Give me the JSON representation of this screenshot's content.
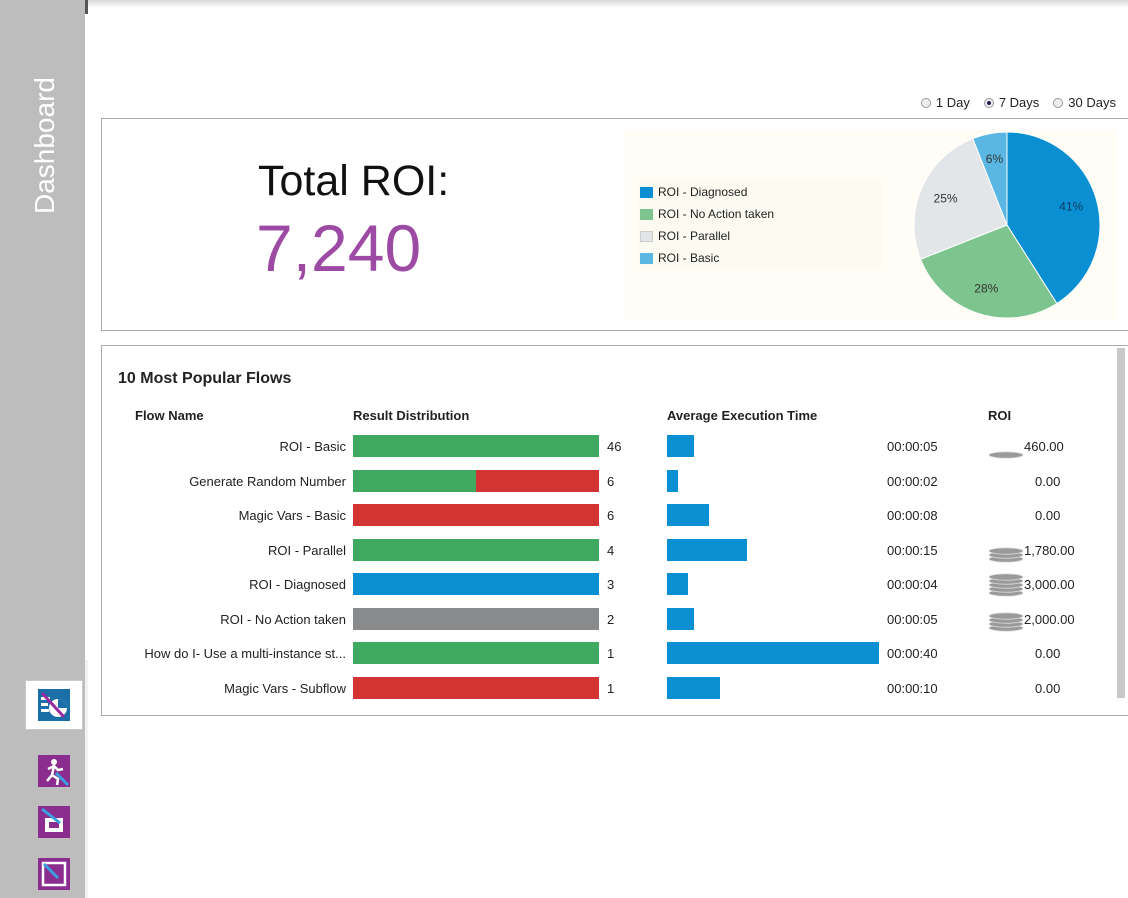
{
  "sidebar": {
    "title": "Dashboard",
    "nav": [
      {
        "name": "dashboard-nav-icon",
        "active": true
      },
      {
        "name": "run-nav-icon",
        "active": false
      },
      {
        "name": "scheduler-nav-icon",
        "active": false
      },
      {
        "name": "content-nav-icon",
        "active": false
      }
    ]
  },
  "range": {
    "options": [
      "1 Day",
      "7 Days",
      "30 Days"
    ],
    "selected": "7 Days"
  },
  "roi": {
    "title": "Total ROI:",
    "value": "7,240"
  },
  "chart_data": {
    "type": "pie",
    "labels": [
      "ROI - Diagnosed",
      "ROI - No Action taken",
      "ROI - Parallel",
      "ROI - Basic"
    ],
    "values": [
      41,
      28,
      25,
      6
    ],
    "value_labels": [
      "41%",
      "28%",
      "25%",
      "6%"
    ],
    "colors": [
      "#0a8fd3",
      "#7dc48e",
      "#e3e6e8",
      "#5ab7e3"
    ]
  },
  "flows": {
    "title": "10 Most Popular Flows",
    "headers": {
      "name": "Flow Name",
      "result": "Result Distribution",
      "time": "Average Execution Time",
      "roi": "ROI"
    },
    "rows": [
      {
        "name": "ROI - Basic",
        "count": "46",
        "time": "00:00:05",
        "roi": "460.00",
        "seconds": 5,
        "coins": 1,
        "segments": [
          {
            "color": "#3fa95f",
            "frac": 1
          }
        ]
      },
      {
        "name": "Generate Random Number",
        "count": "6",
        "time": "00:00:02",
        "roi": "0.00",
        "seconds": 2,
        "coins": 0,
        "segments": [
          {
            "color": "#3fa95f",
            "frac": 0.5
          },
          {
            "color": "#d23434",
            "frac": 0.5
          }
        ]
      },
      {
        "name": "Magic Vars - Basic",
        "count": "6",
        "time": "00:00:08",
        "roi": "0.00",
        "seconds": 8,
        "coins": 0,
        "segments": [
          {
            "color": "#d23434",
            "frac": 1
          }
        ]
      },
      {
        "name": "ROI - Parallel",
        "count": "4",
        "time": "00:00:15",
        "roi": "1,780.00",
        "seconds": 15,
        "coins": 3,
        "segments": [
          {
            "color": "#3fa95f",
            "frac": 1
          }
        ]
      },
      {
        "name": "ROI - Diagnosed",
        "count": "3",
        "time": "00:00:04",
        "roi": "3,000.00",
        "seconds": 4,
        "coins": 5,
        "segments": [
          {
            "color": "#0a8fd3",
            "frac": 1
          }
        ]
      },
      {
        "name": "ROI - No Action taken",
        "count": "2",
        "time": "00:00:05",
        "roi": "2,000.00",
        "seconds": 5,
        "coins": 4,
        "segments": [
          {
            "color": "#888a8c",
            "frac": 1
          }
        ]
      },
      {
        "name": "How do I- Use a multi-instance st...",
        "count": "1",
        "time": "00:00:40",
        "roi": "0.00",
        "seconds": 40,
        "coins": 0,
        "segments": [
          {
            "color": "#3fa95f",
            "frac": 1
          }
        ]
      },
      {
        "name": "Magic Vars - Subflow",
        "count": "1",
        "time": "00:00:10",
        "roi": "0.00",
        "seconds": 10,
        "coins": 0,
        "segments": [
          {
            "color": "#d23434",
            "frac": 1
          }
        ]
      }
    ],
    "time_bar_color": "#0a8fd3"
  }
}
